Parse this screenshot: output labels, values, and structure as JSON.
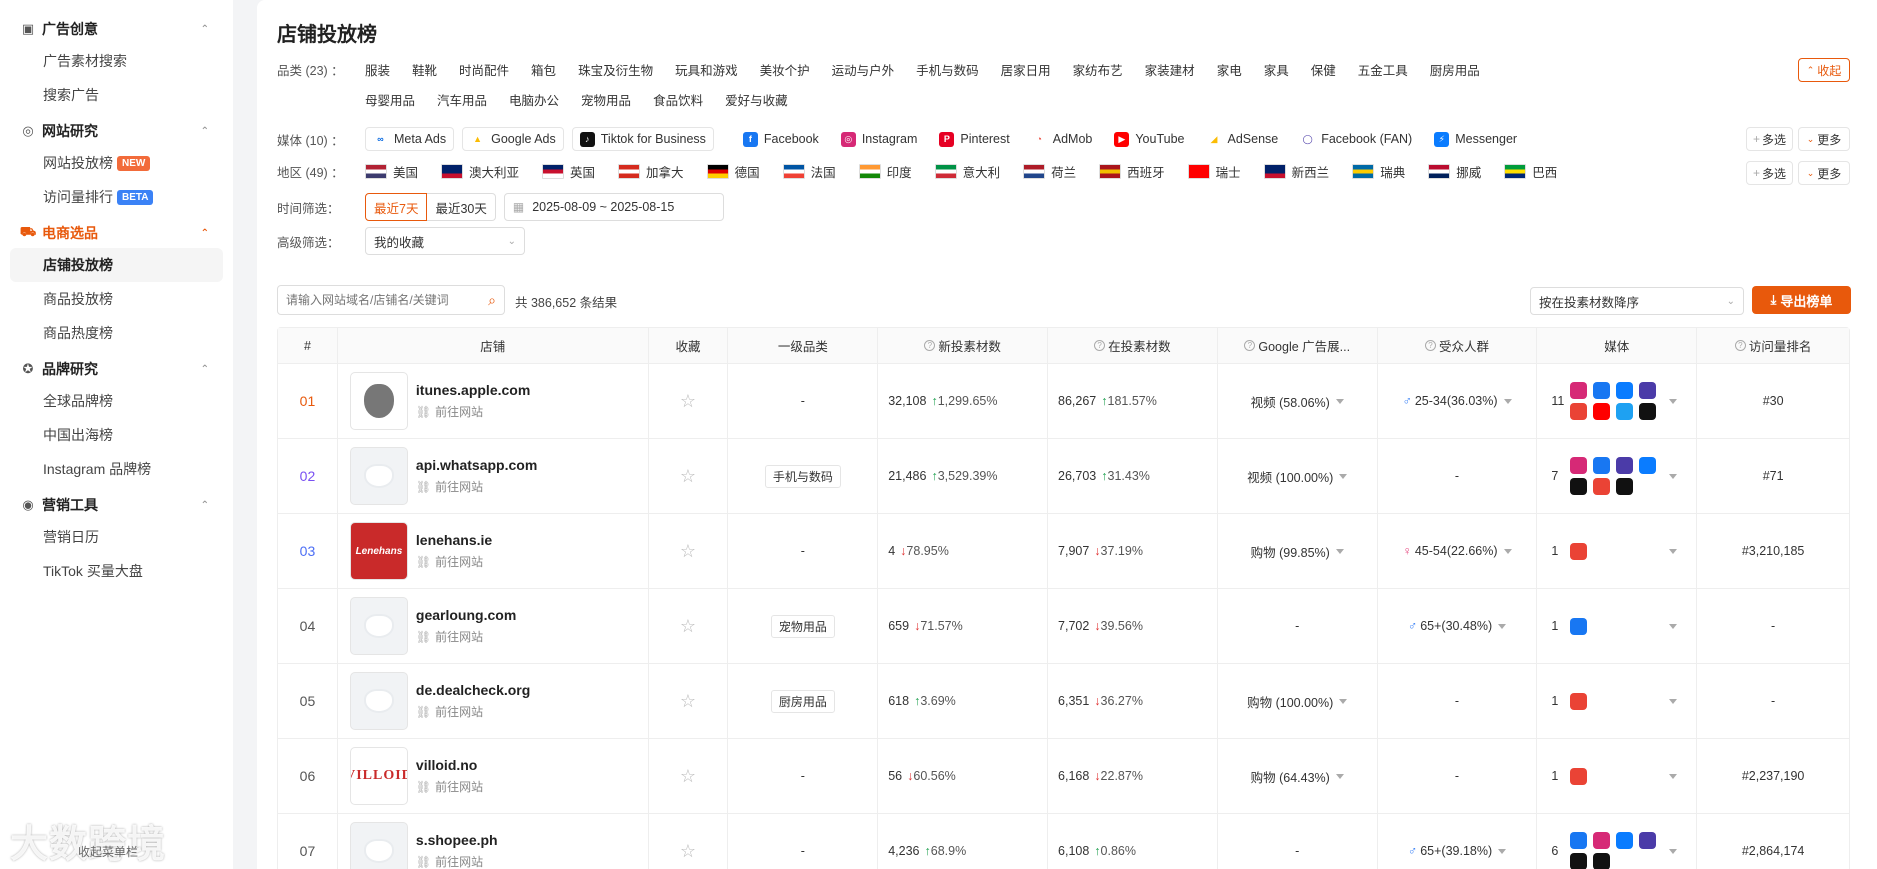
{
  "sidebar": {
    "sections": [
      {
        "label": "广告创意",
        "icon": "image-icon",
        "items": [
          {
            "label": "广告素材搜索"
          },
          {
            "label": "搜索广告"
          }
        ]
      },
      {
        "label": "网站研究",
        "icon": "compass-icon",
        "items": [
          {
            "label": "网站投放榜",
            "badge": "NEW"
          },
          {
            "label": "访问量排行",
            "badge": "BETA"
          }
        ]
      },
      {
        "label": "电商选品",
        "icon": "cart-icon",
        "items": [
          {
            "label": "店铺投放榜"
          },
          {
            "label": "商品投放榜"
          },
          {
            "label": "商品热度榜"
          }
        ]
      },
      {
        "label": "品牌研究",
        "icon": "medal-icon",
        "items": [
          {
            "label": "全球品牌榜"
          },
          {
            "label": "中国出海榜"
          },
          {
            "label": "Instagram 品牌榜"
          }
        ]
      },
      {
        "label": "营销工具",
        "icon": "broadcast-icon",
        "items": [
          {
            "label": "营销日历"
          },
          {
            "label": "TikTok 买量大盘"
          }
        ]
      }
    ],
    "watermark": "大数跨境",
    "bottom_note": "收起菜单栏"
  },
  "page": {
    "title": "店铺投放榜",
    "category_label": "品类 (23) ：",
    "categories": [
      "服装",
      "鞋靴",
      "时尚配件",
      "箱包",
      "珠宝及衍生物",
      "玩具和游戏",
      "美妆个护",
      "运动与户外",
      "手机与数码",
      "居家日用",
      "家纺布艺",
      "家装建材",
      "家电",
      "家具",
      "保健",
      "五金工具",
      "厨房用品",
      "母婴用品",
      "汽车用品",
      "电脑办公",
      "宠物用品",
      "食品饮料",
      "爱好与收藏"
    ],
    "collapse_label": "收起",
    "media_label": "媒体 (10) ：",
    "media": [
      {
        "label": "Meta Ads",
        "color": "#0668e1",
        "glyph": "∞"
      },
      {
        "label": "Google Ads",
        "color": "#fbbc04",
        "glyph": "▲"
      },
      {
        "label": "Tiktok for Business",
        "color": "#111111",
        "glyph": "♪"
      },
      {
        "label": "Facebook",
        "color": "#1877f2",
        "glyph": "f"
      },
      {
        "label": "Instagram",
        "color": "#d62976",
        "glyph": "◎"
      },
      {
        "label": "Pinterest",
        "color": "#e60023",
        "glyph": "P"
      },
      {
        "label": "AdMob",
        "color": "#ea4335",
        "glyph": "◔"
      },
      {
        "label": "YouTube",
        "color": "#ff0000",
        "glyph": "▶"
      },
      {
        "label": "AdSense",
        "color": "#fbbc04",
        "glyph": "◢"
      },
      {
        "label": "Facebook (FAN)",
        "color": "#4b3ba8",
        "glyph": "◯"
      },
      {
        "label": "Messenger",
        "color": "#0a7cff",
        "glyph": "⚡"
      }
    ],
    "multi_label": "多选",
    "more_label": "更多",
    "region_label": "地区 (49) ：",
    "regions": [
      {
        "label": "美国",
        "colors": [
          "#b22234",
          "#ffffff",
          "#3c3b6e"
        ]
      },
      {
        "label": "澳大利亚",
        "colors": [
          "#012169",
          "#012169",
          "#c8102e"
        ]
      },
      {
        "label": "英国",
        "colors": [
          "#012169",
          "#c8102e",
          "#ffffff"
        ]
      },
      {
        "label": "加拿大",
        "colors": [
          "#d52b1e",
          "#ffffff",
          "#d52b1e"
        ]
      },
      {
        "label": "德国",
        "colors": [
          "#000000",
          "#dd0000",
          "#ffce00"
        ]
      },
      {
        "label": "法国",
        "colors": [
          "#0055a4",
          "#ffffff",
          "#ef4135"
        ]
      },
      {
        "label": "印度",
        "colors": [
          "#ff9933",
          "#ffffff",
          "#138808"
        ]
      },
      {
        "label": "意大利",
        "colors": [
          "#009246",
          "#ffffff",
          "#ce2b37"
        ]
      },
      {
        "label": "荷兰",
        "colors": [
          "#ae1c28",
          "#ffffff",
          "#21468b"
        ]
      },
      {
        "label": "西班牙",
        "colors": [
          "#aa151b",
          "#f1bf00",
          "#aa151b"
        ]
      },
      {
        "label": "瑞士",
        "colors": [
          "#ff0000",
          "#ff0000",
          "#ff0000"
        ]
      },
      {
        "label": "新西兰",
        "colors": [
          "#012169",
          "#012169",
          "#c8102e"
        ]
      },
      {
        "label": "瑞典",
        "colors": [
          "#006aa7",
          "#fecc00",
          "#006aa7"
        ]
      },
      {
        "label": "挪威",
        "colors": [
          "#ba0c2f",
          "#ffffff",
          "#00205b"
        ]
      },
      {
        "label": "巴西",
        "colors": [
          "#009c3b",
          "#ffdf00",
          "#002776"
        ]
      }
    ],
    "time_label": "时间筛选：",
    "time_opts": [
      "最近7天",
      "最近30天"
    ],
    "date_range": "2025-08-09 ~ 2025-08-15",
    "adv_label": "高级筛选：",
    "adv_value": "我的收藏",
    "search_placeholder": "请输入网站域名/店铺名/关键词",
    "result_count": "共 386,652 条结果",
    "sort_value": "按在投素材数降序",
    "export_label": "导出榜单"
  },
  "table": {
    "headers": [
      "#",
      "店铺",
      "收藏",
      "一级品类",
      "新投素材数",
      "在投素材数",
      "Google 广告展...",
      "受众人群",
      "媒体",
      "访问量排名"
    ],
    "rows": [
      {
        "rank": "01",
        "rank_color": "#e8590c",
        "domain": "itunes.apple.com",
        "logo": "apple",
        "link": "前往网站",
        "category": "-",
        "new_count": "32,108",
        "new_dir": "up",
        "new_pct": "1,299.65%",
        "cur_count": "86,267",
        "cur_dir": "up",
        "cur_pct": "181.57%",
        "google": "视频 (58.06%)",
        "audience": "25-34(36.03%)",
        "aud_icon": "male",
        "media_count": "11",
        "media_icons": [
          "#d62976",
          "#1877f2",
          "#0a7cff",
          "#4b3ba8",
          "#ea4335",
          "#ff0000",
          "#1ea1f2",
          "#111111"
        ],
        "visit": "#30"
      },
      {
        "rank": "02",
        "rank_color": "#7950f2",
        "domain": "api.whatsapp.com",
        "logo": "blank",
        "link": "前往网站",
        "category": "手机与数码",
        "new_count": "21,486",
        "new_dir": "up",
        "new_pct": "3,529.39%",
        "cur_count": "26,703",
        "cur_dir": "up",
        "cur_pct": "31.43%",
        "google": "视频 (100.00%)",
        "audience": "-",
        "aud_icon": "",
        "media_count": "7",
        "media_icons": [
          "#d62976",
          "#1877f2",
          "#4b3ba8",
          "#0a7cff",
          "#111111",
          "#ea4335",
          "#111111"
        ],
        "visit": "#71"
      },
      {
        "rank": "03",
        "rank_color": "#4c6ef5",
        "domain": "lenehans.ie",
        "logo": "lenehans",
        "link": "前往网站",
        "category": "-",
        "new_count": "4",
        "new_dir": "down",
        "new_pct": "78.95%",
        "cur_count": "7,907",
        "cur_dir": "down",
        "cur_pct": "37.19%",
        "google": "购物 (99.85%)",
        "audience": "45-54(22.66%)",
        "aud_icon": "female",
        "media_count": "1",
        "media_icons": [
          "#ea4335"
        ],
        "visit": "#3,210,185"
      },
      {
        "rank": "04",
        "rank_color": "#555555",
        "domain": "gearloung.com",
        "logo": "blank",
        "link": "前往网站",
        "category": "宠物用品",
        "new_count": "659",
        "new_dir": "down",
        "new_pct": "71.57%",
        "cur_count": "7,702",
        "cur_dir": "down",
        "cur_pct": "39.56%",
        "google": "-",
        "audience": "65+(30.48%)",
        "aud_icon": "male",
        "media_count": "1",
        "media_icons": [
          "#1877f2"
        ],
        "visit": "-"
      },
      {
        "rank": "05",
        "rank_color": "#555555",
        "domain": "de.dealcheck.org",
        "logo": "blank",
        "link": "前往网站",
        "category": "厨房用品",
        "new_count": "618",
        "new_dir": "up",
        "new_pct": "3.69%",
        "cur_count": "6,351",
        "cur_dir": "down",
        "cur_pct": "36.27%",
        "google": "购物 (100.00%)",
        "audience": "-",
        "aud_icon": "",
        "media_count": "1",
        "media_icons": [
          "#ea4335"
        ],
        "visit": "-"
      },
      {
        "rank": "06",
        "rank_color": "#555555",
        "domain": "villoid.no",
        "logo": "villoid",
        "link": "前往网站",
        "category": "-",
        "new_count": "56",
        "new_dir": "down",
        "new_pct": "60.56%",
        "cur_count": "6,168",
        "cur_dir": "down",
        "cur_pct": "22.87%",
        "google": "购物 (64.43%)",
        "audience": "-",
        "aud_icon": "",
        "media_count": "1",
        "media_icons": [
          "#ea4335"
        ],
        "visit": "#2,237,190"
      },
      {
        "rank": "07",
        "rank_color": "#555555",
        "domain": "s.shopee.ph",
        "logo": "blank",
        "link": "前往网站",
        "category": "-",
        "new_count": "4,236",
        "new_dir": "up",
        "new_pct": "68.9%",
        "cur_count": "6,108",
        "cur_dir": "up",
        "cur_pct": "0.86%",
        "google": "-",
        "audience": "65+(39.18%)",
        "aud_icon": "male",
        "media_count": "6",
        "media_icons": [
          "#1877f2",
          "#d62976",
          "#0a7cff",
          "#4b3ba8",
          "#111111",
          "#111111"
        ],
        "visit": "#2,864,174"
      }
    ]
  }
}
